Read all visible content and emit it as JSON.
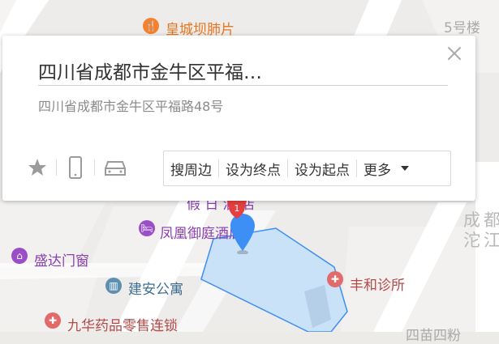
{
  "popup": {
    "title": "四川省成都市金牛区平福…",
    "address": "四川省成都市金牛区平福路48号",
    "close_icon": "close-icon",
    "icons": [
      "star-icon",
      "phone-icon",
      "car-icon"
    ],
    "actions": [
      "搜周边",
      "设为终点",
      "设为起点",
      "更多"
    ]
  },
  "map": {
    "labels": {
      "top_restaurant": "皇城坝肺片",
      "building": "5号楼",
      "hotel": "凤凰御庭酒店",
      "shop": "盛达门窗",
      "apartment": "建安公寓",
      "clinic": "丰和诊所",
      "pharmacy": "九华药品零售连锁",
      "partial_hotel": "假 日 酒 店",
      "road_col1": "成沱",
      "road_col2": "都江",
      "bottom_right": "四苗四粉"
    },
    "marker_badge": "1",
    "highlight_color": "#c9e2f8",
    "marker_color": "#3d8ef5",
    "poi_text_color": "#8a3fb0"
  }
}
